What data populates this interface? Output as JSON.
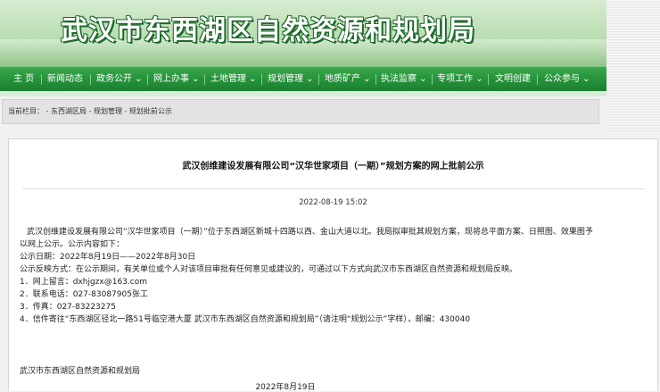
{
  "header": {
    "title": "武汉市东西湖区自然资源和规划局"
  },
  "nav": {
    "items": [
      {
        "label": "主 页"
      },
      {
        "label": "新闻动态"
      },
      {
        "label": "政务公开 ⌄"
      },
      {
        "label": "网上办事 ⌄"
      },
      {
        "label": "土地管理 ⌄"
      },
      {
        "label": "规划管理 ⌄"
      },
      {
        "label": "地质矿产 ⌄"
      },
      {
        "label": "执法监察 ⌄"
      },
      {
        "label": "专项工作 ⌄"
      },
      {
        "label": "文明创建"
      },
      {
        "label": "公众参与 ⌄"
      }
    ]
  },
  "breadcrumb": {
    "text": "当前栏目： - 东西湖区局 - 规划管理 - 规划批前公示"
  },
  "article": {
    "title": "武汉创维建设发展有限公司“汉华世家项目（一期）”规划方案的网上批前公示",
    "date": "2022-08-19 15:02",
    "paragraph1_line1": "武汉创维建设发展有限公司“汉华世家项目（一期）”位于东西湖区新城十四路以西、金山大道以北。我局拟审批其规划方案，现将总平面方案、日照图、效果图予",
    "paragraph1_line2": "以网上公示。公示内容如下：",
    "notice_period": "公示日期：2022年8月19日——2022年8月30日",
    "feedback_intro": "公示反映方式：在公示期间，有关单位或个人对该项目审批有任何意见或建议的，可通过以下方式向武汉市东西湖区自然资源和规划局反映。",
    "contact_1": "1．网上留言：dxhjgzx@163.com",
    "contact_2": "2．联系电话：027-83087905张工",
    "contact_3": "3．传真：027-83223275",
    "contact_4": "4．信件寄往“东西湖区径北一路51号临空港大厦   武汉市东西湖区自然资源和规划局”（请注明“规划公示”字样），邮编：430040",
    "signature_org": "武汉市东西湖区自然资源和规划局",
    "signature_date": "2022年8月19日"
  }
}
